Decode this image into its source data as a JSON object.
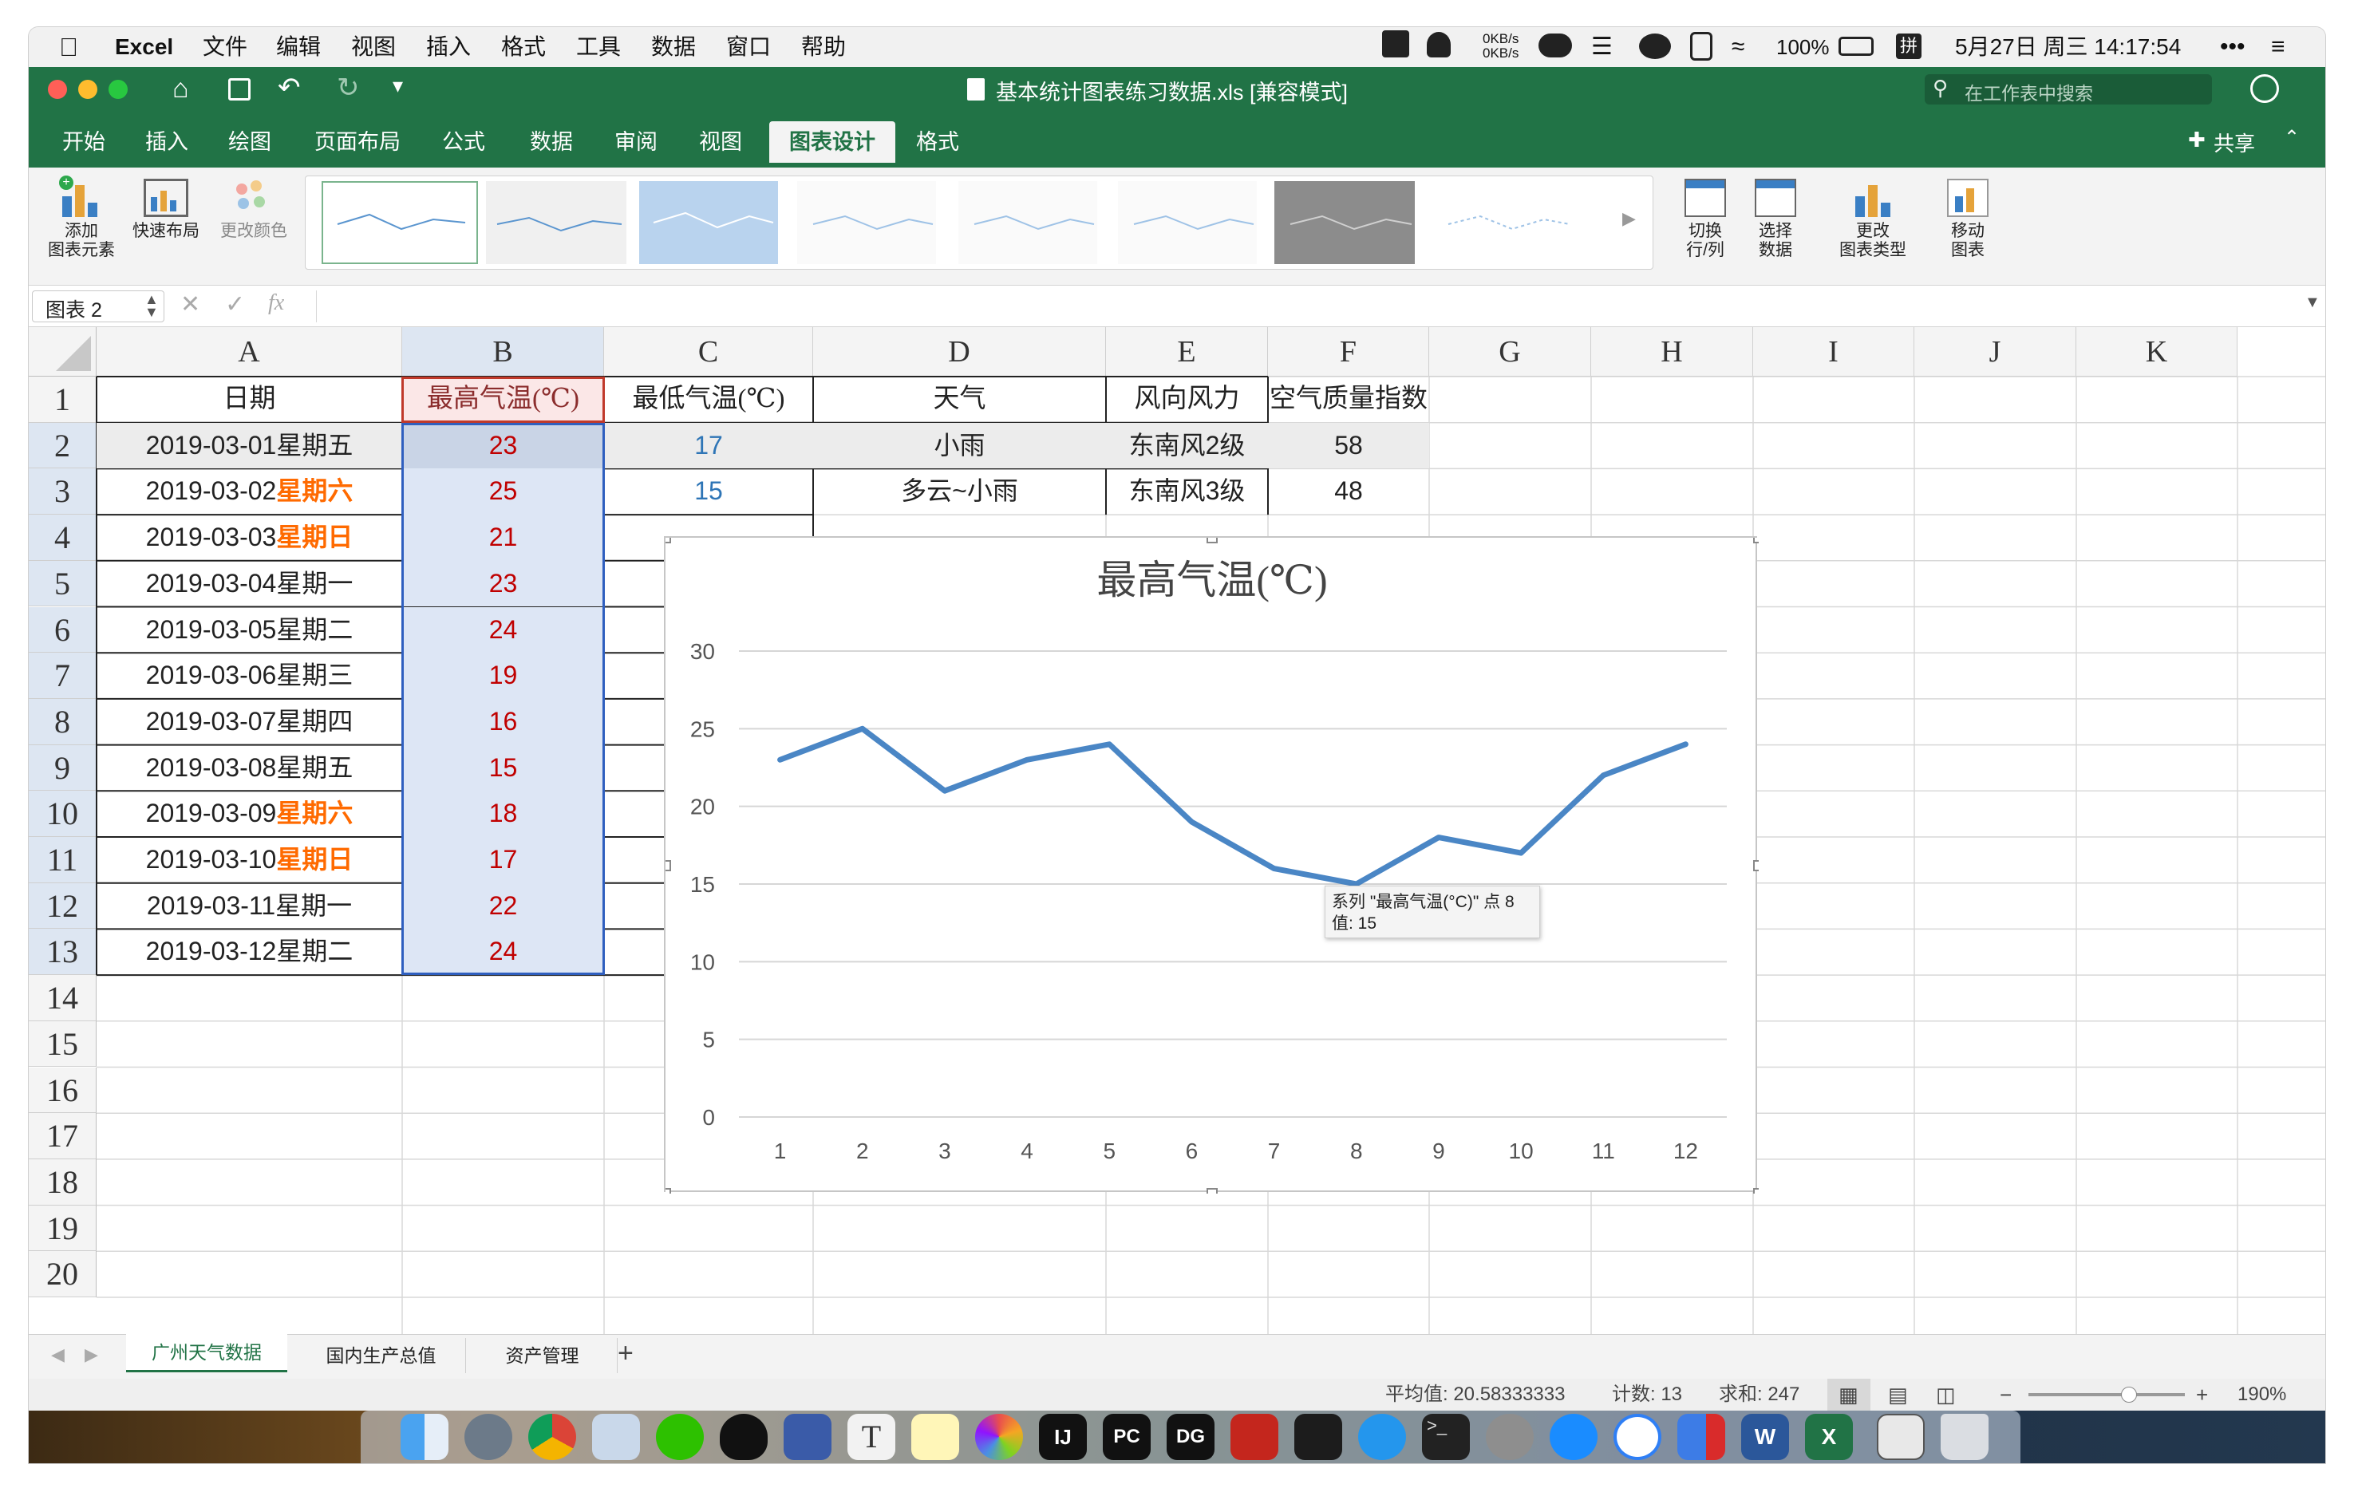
{
  "menubar": {
    "app_name": "Excel",
    "items": [
      "文件",
      "编辑",
      "视图",
      "插入",
      "格式",
      "工具",
      "数据",
      "窗口",
      "帮助"
    ],
    "net_speed_up": "0KB/s",
    "net_speed_down": "0KB/s",
    "battery": "100%",
    "input_method": "拼",
    "datetime": "5月27日 周三  14:17:54"
  },
  "titlebar": {
    "doc_title": "基本统计图表练习数据.xls [兼容模式]",
    "search_placeholder": "在工作表中搜索"
  },
  "ribbon_tabs": {
    "tabs": [
      "开始",
      "插入",
      "绘图",
      "页面布局",
      "公式",
      "数据",
      "审阅",
      "视图",
      "图表设计",
      "格式"
    ],
    "active": "图表设计",
    "share": "共享"
  },
  "ribbon": {
    "add_element": "添加\n图表元素",
    "quick_layout": "快速布局",
    "change_color": "更改颜色",
    "switch_row_col": "切换\n行/列",
    "select_data": "选择\n数据",
    "change_type": "更改\n图表类型",
    "move_chart": "移动\n图表"
  },
  "formula_bar": {
    "name_box": "图表 2",
    "fx": "fx",
    "value": ""
  },
  "columns": [
    "A",
    "B",
    "C",
    "D",
    "E",
    "F",
    "G",
    "H",
    "I",
    "J",
    "K"
  ],
  "rows": [
    "1",
    "2",
    "3",
    "4",
    "5",
    "6",
    "7",
    "8",
    "9",
    "10",
    "11",
    "12",
    "13",
    "14",
    "15",
    "16",
    "17",
    "18",
    "19",
    "20"
  ],
  "headers": [
    "日期",
    "最高气温(℃)",
    "最低气温(℃)",
    "天气",
    "风向风力",
    "空气质量指数"
  ],
  "dates": [
    {
      "date": "2019-03-01",
      "day": "星期五",
      "weekend": false
    },
    {
      "date": "2019-03-02",
      "day": "星期六",
      "weekend": true
    },
    {
      "date": "2019-03-03",
      "day": "星期日",
      "weekend": true
    },
    {
      "date": "2019-03-04",
      "day": "星期一",
      "weekend": false
    },
    {
      "date": "2019-03-05",
      "day": "星期二",
      "weekend": false
    },
    {
      "date": "2019-03-06",
      "day": "星期三",
      "weekend": false
    },
    {
      "date": "2019-03-07",
      "day": "星期四",
      "weekend": false
    },
    {
      "date": "2019-03-08",
      "day": "星期五",
      "weekend": false
    },
    {
      "date": "2019-03-09",
      "day": "星期六",
      "weekend": true
    },
    {
      "date": "2019-03-10",
      "day": "星期日",
      "weekend": true
    },
    {
      "date": "2019-03-11",
      "day": "星期一",
      "weekend": false
    },
    {
      "date": "2019-03-12",
      "day": "星期二",
      "weekend": false
    }
  ],
  "high_temps": [
    "23",
    "25",
    "21",
    "23",
    "24",
    "19",
    "16",
    "15",
    "18",
    "17",
    "22",
    "24"
  ],
  "visible_low_temps": [
    "17",
    "15"
  ],
  "visible_weather": [
    "小雨",
    "多云~小雨"
  ],
  "visible_wind": [
    "东南风2级",
    "东南风3级"
  ],
  "visible_aqi": [
    "58",
    "48"
  ],
  "chart_data": {
    "type": "line",
    "title": "最高气温(℃)",
    "x": [
      1,
      2,
      3,
      4,
      5,
      6,
      7,
      8,
      9,
      10,
      11,
      12
    ],
    "series": [
      {
        "values": [
          23,
          25,
          21,
          23,
          24,
          19,
          16,
          15,
          18,
          17,
          22,
          24
        ]
      }
    ],
    "ylim": [
      0,
      30
    ],
    "yticks": [
      "0",
      "5",
      "10",
      "15",
      "20",
      "25",
      "30"
    ],
    "xticks": [
      "1",
      "2",
      "3",
      "4",
      "5",
      "6",
      "7",
      "8",
      "9",
      "10",
      "11",
      "12"
    ],
    "grid": true,
    "line_color": "#4a86c5"
  },
  "tooltip": {
    "line1": "系列 \"最高气温(°C)\" 点 8",
    "line2": "值: 15"
  },
  "sheet_tabs": {
    "tabs": [
      "广州天气数据",
      "国内生产总值",
      "资产管理"
    ],
    "active": "广州天气数据",
    "add": "+"
  },
  "status_bar": {
    "average": "平均值: 20.58333333",
    "count": "计数: 13",
    "sum": "求和: 247",
    "zoom": "190%"
  },
  "colors": {
    "excel_green": "#217346",
    "weekend_orange": "#ff6a00",
    "high_temp_red": "#c00000",
    "low_temp_blue": "#2e75b6",
    "selection_fill": "#dde6f5"
  }
}
